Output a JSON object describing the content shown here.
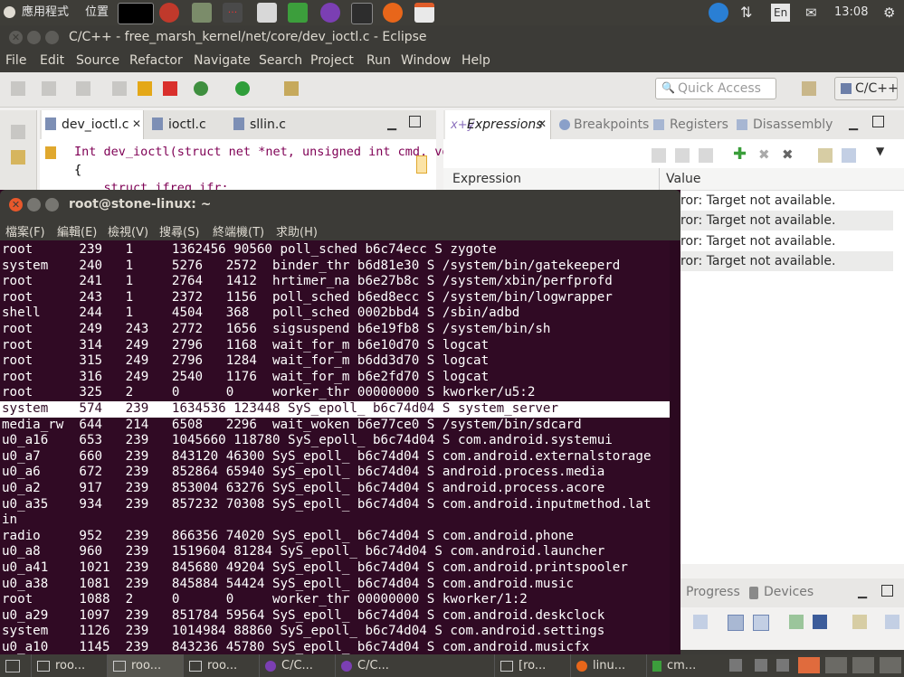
{
  "topbar": {
    "apps_label": "應用程式",
    "places_label": "位置",
    "lang": "En",
    "time": "13:08"
  },
  "eclipse": {
    "title": "C/C++ - free_marsh_kernel/net/core/dev_ioctl.c - Eclipse",
    "menu": [
      "File",
      "Edit",
      "Source",
      "Refactor",
      "Navigate",
      "Search",
      "Project",
      "Run",
      "Window",
      "Help"
    ],
    "quick_access_placeholder": "Quick Access",
    "perspective": "C/C++",
    "editor_tabs": [
      "dev_ioctl.c",
      "ioctl.c",
      "sllin.c"
    ],
    "code_lines": [
      "Int dev_ioctl(struct net *net, unsigned int cmd, void",
      "{",
      "    struct ifreq ifr;"
    ],
    "expr_tabs": [
      "Expressions",
      "Breakpoints",
      "Registers",
      "Disassembly"
    ],
    "expr_columns": [
      "Expression",
      "Value"
    ],
    "expr_values": [
      "ror: Target not available.",
      "ror: Target not available.",
      "ror: Target not available.",
      "ror: Target not available."
    ],
    "lower_tabs": [
      "Progress",
      "Devices"
    ]
  },
  "terminal": {
    "title": "root@stone-linux: ~",
    "menu": [
      "檔案(F)",
      "編輯(E)",
      "檢視(V)",
      "搜尋(S)",
      "終端機(T)",
      "求助(H)"
    ],
    "lines": [
      "root      239   1     1362456 90560 poll_sched b6c74ecc S zygote",
      "system    240   1     5276   2572  binder_thr b6d81e30 S /system/bin/gatekeeperd",
      "root      241   1     2764   1412  hrtimer_na b6e27b8c S /system/xbin/perfprofd",
      "root      243   1     2372   1156  poll_sched b6ed8ecc S /system/bin/logwrapper",
      "shell     244   1     4504   368   poll_sched 0002bbd4 S /sbin/adbd",
      "root      249   243   2772   1656  sigsuspend b6e19fb8 S /system/bin/sh",
      "root      314   249   2796   1168  wait_for_m b6e10d70 S logcat",
      "root      315   249   2796   1284  wait_for_m b6dd3d70 S logcat",
      "root      316   249   2540   1176  wait_for_m b6e2fd70 S logcat",
      "root      325   2     0      0     worker_thr 00000000 S kworker/u5:2",
      "system    574   239   1634536 123448 SyS_epoll_ b6c74d04 S system_server",
      "media_rw  644   214   6508   2296  wait_woken b6e77ce0 S /system/bin/sdcard",
      "u0_a16    653   239   1045660 118780 SyS_epoll_ b6c74d04 S com.android.systemui",
      "u0_a7     660   239   843120 46300 SyS_epoll_ b6c74d04 S com.android.externalstorage",
      "u0_a6     672   239   852864 65940 SyS_epoll_ b6c74d04 S android.process.media",
      "u0_a2     917   239   853004 63276 SyS_epoll_ b6c74d04 S android.process.acore",
      "u0_a35    934   239   857232 70308 SyS_epoll_ b6c74d04 S com.android.inputmethod.lat",
      "in",
      "radio     952   239   866356 74020 SyS_epoll_ b6c74d04 S com.android.phone",
      "u0_a8     960   239   1519604 81284 SyS_epoll_ b6c74d04 S com.android.launcher",
      "u0_a41    1021  239   845680 49204 SyS_epoll_ b6c74d04 S com.android.printspooler",
      "u0_a38    1081  239   845884 54424 SyS_epoll_ b6c74d04 S com.android.music",
      "root      1088  2     0      0     worker_thr 00000000 S kworker/1:2",
      "u0_a29    1097  239   851784 59564 SyS_epoll_ b6c74d04 S com.android.deskclock",
      "system    1126  239   1014984 88860 SyS_epoll_ b6c74d04 S com.android.settings",
      "u0_a10    1145  239   843236 45780 SyS_epoll_ b6c74d04 S com.android.musicfx"
    ]
  },
  "taskbar": {
    "items": [
      "roo...",
      "roo...",
      "roo...",
      "C/C...",
      "C/C...",
      "[ro...",
      "linu...",
      "cm..."
    ]
  }
}
